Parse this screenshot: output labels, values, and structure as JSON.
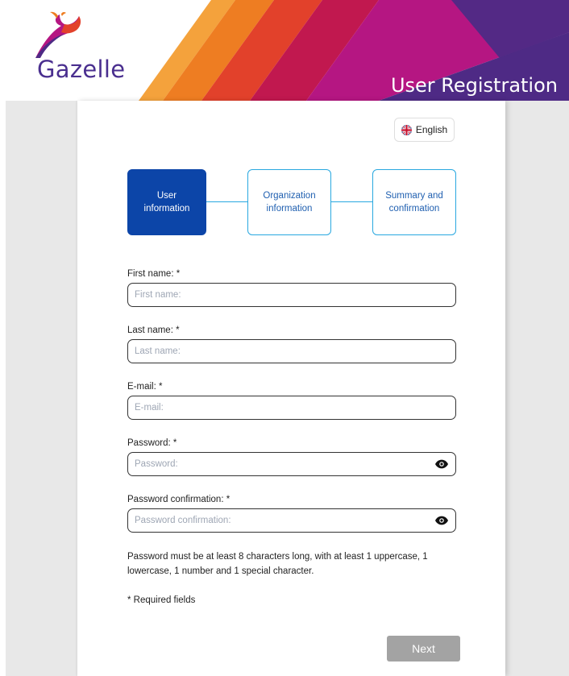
{
  "header": {
    "brand_name": "Gazelle",
    "page_heading": "User Registration",
    "colors": {
      "orange_light": "#f4a23c",
      "orange": "#ee7d22",
      "red": "#e2412b",
      "crimson": "#c1184f",
      "magenta": "#b51682",
      "purple": "#4e2a85",
      "brand_text": "#4a2f8f"
    }
  },
  "language": {
    "label": "English",
    "icon": "uk-flag-icon"
  },
  "steps": [
    {
      "label": "User information",
      "active": true
    },
    {
      "label": "Organization information",
      "active": false
    },
    {
      "label": "Summary and confirmation",
      "active": false
    }
  ],
  "form": {
    "first_name": {
      "label": "First name: *",
      "placeholder": "First name:",
      "value": ""
    },
    "last_name": {
      "label": "Last name: *",
      "placeholder": "Last name:",
      "value": ""
    },
    "email": {
      "label": "E-mail: *",
      "placeholder": "E-mail:",
      "value": ""
    },
    "password": {
      "label": "Password: *",
      "placeholder": "Password:",
      "value": "",
      "icon": "eye-icon"
    },
    "password_confirmation": {
      "label": "Password confirmation: *",
      "placeholder": "Password confirmation:",
      "value": "",
      "icon": "eye-icon"
    }
  },
  "password_hint": "Password must be at least 8 characters long, with at least 1 uppercase, 1 lowercase, 1 number and 1 special character.",
  "required_note": "* Required fields",
  "next_button": {
    "label": "Next",
    "color": "#a3a3a3"
  },
  "colors": {
    "active_step": "#0c45a8",
    "step_border": "#29a8e0",
    "step_text": "#1f5fb0",
    "background": "#e8e8e8"
  }
}
